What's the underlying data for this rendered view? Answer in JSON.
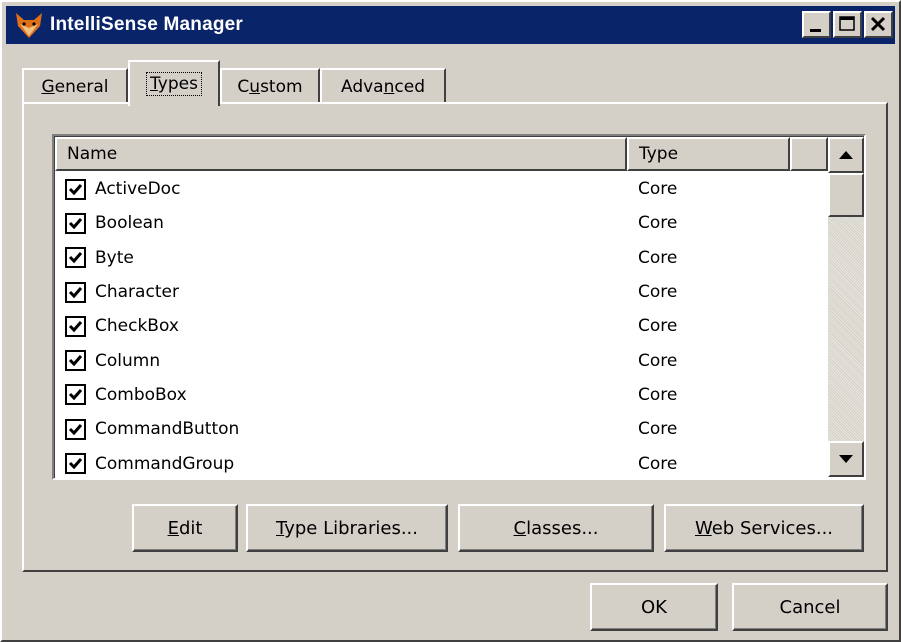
{
  "window": {
    "title": "IntelliSense Manager",
    "icon": "fox-icon"
  },
  "titlebar_buttons": [
    {
      "name": "minimize",
      "icon": "minimize-icon"
    },
    {
      "name": "maximize",
      "icon": "maximize-icon"
    },
    {
      "name": "close",
      "icon": "close-icon"
    }
  ],
  "tabs": [
    {
      "label": "General",
      "mnemonic": "G",
      "rest": "eneral",
      "active": false
    },
    {
      "label": "Types",
      "mnemonic": "T",
      "rest": "ypes",
      "active": true
    },
    {
      "label": "Custom",
      "pre": "C",
      "mnemonic": "u",
      "rest": "stom",
      "active": false
    },
    {
      "label": "Advanced",
      "pre": "Adva",
      "mnemonic": "n",
      "rest": "ced",
      "active": false
    }
  ],
  "list": {
    "columns": [
      "Name",
      "Type",
      ""
    ],
    "rows": [
      {
        "checked": true,
        "name": "ActiveDoc",
        "type": "Core"
      },
      {
        "checked": true,
        "name": "Boolean",
        "type": "Core"
      },
      {
        "checked": true,
        "name": "Byte",
        "type": "Core"
      },
      {
        "checked": true,
        "name": "Character",
        "type": "Core"
      },
      {
        "checked": true,
        "name": "CheckBox",
        "type": "Core"
      },
      {
        "checked": true,
        "name": "Column",
        "type": "Core"
      },
      {
        "checked": true,
        "name": "ComboBox",
        "type": "Core"
      },
      {
        "checked": true,
        "name": "CommandButton",
        "type": "Core"
      },
      {
        "checked": true,
        "name": "CommandGroup",
        "type": "Core"
      }
    ]
  },
  "panel_buttons": {
    "edit": {
      "mnemonic": "E",
      "rest": "dit"
    },
    "type_libraries": {
      "mnemonic": "T",
      "rest": "ype Libraries..."
    },
    "classes": {
      "mnemonic": "C",
      "rest": "lasses..."
    },
    "web_services": {
      "mnemonic": "W",
      "rest": "eb Services..."
    }
  },
  "dialog_buttons": {
    "ok": "OK",
    "cancel": "Cancel"
  },
  "colors": {
    "face": "#d4d0c8",
    "titlebar": "#0a246a",
    "highlight": "#ffffff",
    "shadow": "#404040"
  }
}
